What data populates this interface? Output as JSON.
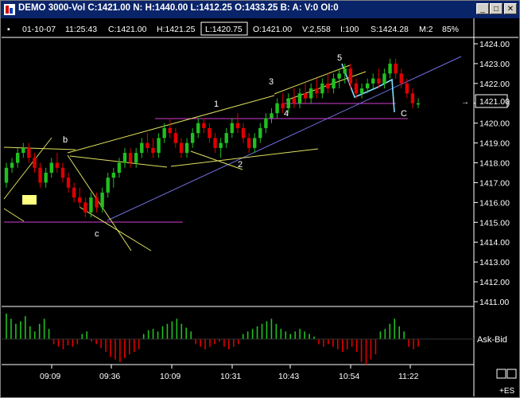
{
  "window": {
    "title": "DEMO 3000-Vol C:1421.00 N: H:1440.00 L:1412.25 O:1433.25 B: A: V:0 OI:0",
    "minimize_glyph": "_",
    "maximize_glyph": "□",
    "close_glyph": "✕"
  },
  "info_bar": {
    "date": "01-10-07",
    "time": "11:25:43",
    "close": "C:1421.00",
    "high": "H:1421.25",
    "low": "L:1420.75",
    "open": "O:1421.00",
    "volume": "V:2,558",
    "interval": "I:100",
    "settle": "S:1424.28",
    "multiplier": "M:2",
    "zoom": "85%"
  },
  "price_axis": {
    "labels": [
      "1424.00",
      "1423.00",
      "1422.00",
      "1421.00",
      "1420.00",
      "1419.00",
      "1418.00",
      "1417.00",
      "1416.00",
      "1415.00",
      "1414.00",
      "1413.00",
      "1412.00",
      "1411.00"
    ],
    "current_price": "1421.00",
    "current_marker": "→"
  },
  "time_axis": [
    "09:09",
    "09:36",
    "10:09",
    "10:31",
    "10:43",
    "10:54",
    "11:22"
  ],
  "indicator": {
    "label": "Ask-Bid"
  },
  "symbol": "+ES",
  "annotations": [
    "b",
    "c",
    "1",
    "2",
    "3",
    "4",
    "5",
    "C"
  ],
  "colors": {
    "up": "#20c020",
    "down": "#e00000",
    "yellow_lines": "#e0e060",
    "trend_line": "#7070e0",
    "horizontal": "#d040d0",
    "cyan_wave": "#80e0ff",
    "price_box": "#ffff80"
  },
  "chart_data": {
    "type": "candlestick",
    "ylim": [
      1411.0,
      1424.5
    ],
    "x": [
      "09:09",
      "09:36",
      "10:09",
      "10:31",
      "10:43",
      "10:54",
      "11:22"
    ],
    "candles": [
      [
        1417.0,
        1418.0,
        1416.75,
        1417.75
      ],
      [
        1417.75,
        1418.25,
        1417.5,
        1418.0
      ],
      [
        1418.0,
        1418.75,
        1417.75,
        1418.5
      ],
      [
        1418.5,
        1419.0,
        1418.25,
        1418.75
      ],
      [
        1418.75,
        1419.0,
        1418.0,
        1418.25
      ],
      [
        1418.25,
        1418.5,
        1417.5,
        1417.75
      ],
      [
        1417.75,
        1418.0,
        1416.75,
        1417.0
      ],
      [
        1417.0,
        1417.75,
        1416.75,
        1417.5
      ],
      [
        1417.5,
        1418.25,
        1417.25,
        1418.0
      ],
      [
        1418.0,
        1418.5,
        1417.5,
        1417.75
      ],
      [
        1417.75,
        1418.0,
        1417.0,
        1417.25
      ],
      [
        1417.25,
        1417.5,
        1416.5,
        1416.75
      ],
      [
        1416.75,
        1417.0,
        1416.0,
        1416.25
      ],
      [
        1416.25,
        1416.75,
        1415.75,
        1416.0
      ],
      [
        1416.0,
        1416.25,
        1415.25,
        1415.5
      ],
      [
        1415.5,
        1416.5,
        1415.25,
        1416.25
      ],
      [
        1416.25,
        1416.5,
        1415.5,
        1415.75
      ],
      [
        1415.75,
        1416.75,
        1415.5,
        1416.5
      ],
      [
        1416.5,
        1417.5,
        1416.25,
        1417.25
      ],
      [
        1417.25,
        1417.75,
        1416.75,
        1417.5
      ],
      [
        1417.5,
        1418.25,
        1417.25,
        1418.0
      ],
      [
        1418.0,
        1418.75,
        1417.75,
        1418.5
      ],
      [
        1418.5,
        1418.75,
        1417.75,
        1418.0
      ],
      [
        1418.0,
        1418.75,
        1417.75,
        1418.5
      ],
      [
        1418.5,
        1419.25,
        1418.25,
        1419.0
      ],
      [
        1419.0,
        1419.5,
        1418.5,
        1418.75
      ],
      [
        1418.75,
        1419.25,
        1418.25,
        1418.5
      ],
      [
        1418.5,
        1419.5,
        1418.25,
        1419.25
      ],
      [
        1419.25,
        1420.0,
        1419.0,
        1419.75
      ],
      [
        1419.75,
        1420.25,
        1419.25,
        1419.5
      ],
      [
        1419.5,
        1419.75,
        1418.75,
        1419.0
      ],
      [
        1419.0,
        1419.25,
        1418.25,
        1418.5
      ],
      [
        1418.5,
        1419.25,
        1418.25,
        1419.0
      ],
      [
        1419.0,
        1419.75,
        1418.75,
        1419.5
      ],
      [
        1419.5,
        1420.25,
        1419.25,
        1420.0
      ],
      [
        1420.0,
        1420.25,
        1419.5,
        1419.75
      ],
      [
        1419.75,
        1420.0,
        1419.0,
        1419.25
      ],
      [
        1419.25,
        1419.5,
        1418.5,
        1418.75
      ],
      [
        1418.75,
        1419.25,
        1418.25,
        1419.0
      ],
      [
        1419.0,
        1419.75,
        1418.75,
        1419.5
      ],
      [
        1419.5,
        1420.25,
        1419.25,
        1420.0
      ],
      [
        1420.0,
        1420.5,
        1419.5,
        1419.75
      ],
      [
        1419.75,
        1420.0,
        1419.0,
        1419.25
      ],
      [
        1419.25,
        1419.5,
        1418.5,
        1418.75
      ],
      [
        1418.75,
        1419.5,
        1418.5,
        1419.25
      ],
      [
        1419.25,
        1420.0,
        1419.0,
        1419.75
      ],
      [
        1419.75,
        1420.5,
        1419.5,
        1420.25
      ],
      [
        1420.25,
        1420.75,
        1420.0,
        1420.5
      ],
      [
        1420.5,
        1421.25,
        1420.25,
        1421.0
      ],
      [
        1421.0,
        1421.5,
        1420.5,
        1420.75
      ],
      [
        1420.75,
        1421.5,
        1420.5,
        1421.25
      ],
      [
        1421.25,
        1421.75,
        1420.75,
        1421.0
      ],
      [
        1421.0,
        1421.75,
        1420.75,
        1421.5
      ],
      [
        1421.5,
        1422.0,
        1421.0,
        1421.25
      ],
      [
        1421.25,
        1422.0,
        1421.0,
        1421.75
      ],
      [
        1421.75,
        1422.25,
        1421.25,
        1421.5
      ],
      [
        1421.5,
        1422.25,
        1421.25,
        1422.0
      ],
      [
        1422.0,
        1422.5,
        1421.5,
        1421.75
      ],
      [
        1421.75,
        1422.5,
        1421.5,
        1422.25
      ],
      [
        1422.25,
        1422.75,
        1421.75,
        1422.5
      ],
      [
        1422.5,
        1423.0,
        1422.0,
        1422.75
      ],
      [
        1422.75,
        1423.0,
        1421.75,
        1422.0
      ],
      [
        1422.0,
        1422.25,
        1421.25,
        1421.5
      ],
      [
        1421.5,
        1422.0,
        1421.25,
        1421.75
      ],
      [
        1421.75,
        1422.25,
        1421.5,
        1422.0
      ],
      [
        1422.0,
        1422.5,
        1421.75,
        1422.25
      ],
      [
        1422.25,
        1422.75,
        1421.75,
        1422.0
      ],
      [
        1422.0,
        1422.75,
        1421.75,
        1422.5
      ],
      [
        1422.5,
        1423.25,
        1422.25,
        1423.0
      ],
      [
        1423.0,
        1423.25,
        1422.25,
        1422.5
      ],
      [
        1422.5,
        1422.75,
        1421.75,
        1422.0
      ],
      [
        1422.0,
        1422.25,
        1421.25,
        1421.5
      ],
      [
        1421.5,
        1421.75,
        1420.75,
        1421.0
      ],
      [
        1421.0,
        1421.25,
        1420.75,
        1421.0
      ]
    ],
    "ask_bid": [
      1.0,
      0.8,
      0.6,
      0.7,
      0.9,
      0.5,
      0.3,
      0.6,
      0.8,
      0.4,
      -0.2,
      -0.3,
      -0.4,
      -0.25,
      -0.3,
      -0.2,
      0.2,
      0.3,
      -0.1,
      -0.2,
      -0.35,
      -0.5,
      -0.7,
      -0.8,
      -0.9,
      -0.75,
      -0.6,
      -0.5,
      -0.4,
      0.2,
      0.35,
      0.4,
      0.3,
      0.5,
      0.6,
      0.7,
      0.8,
      0.6,
      0.45,
      0.3,
      -0.2,
      -0.3,
      -0.4,
      -0.3,
      -0.2,
      -0.1,
      -0.3,
      -0.4,
      -0.3,
      -0.2,
      0.2,
      0.3,
      0.4,
      0.5,
      0.6,
      0.7,
      0.8,
      0.6,
      0.4,
      0.3,
      0.2,
      0.3,
      0.4,
      0.3,
      0.2,
      0.1,
      -0.2,
      -0.3,
      -0.2,
      -0.3,
      -0.4,
      -0.5,
      -0.4,
      -0.3,
      -0.5,
      -0.9,
      -1.0,
      -0.8,
      -0.6,
      0.3,
      0.4,
      0.6,
      0.8,
      0.5,
      0.3,
      -0.3,
      -0.4,
      -0.3
    ]
  }
}
